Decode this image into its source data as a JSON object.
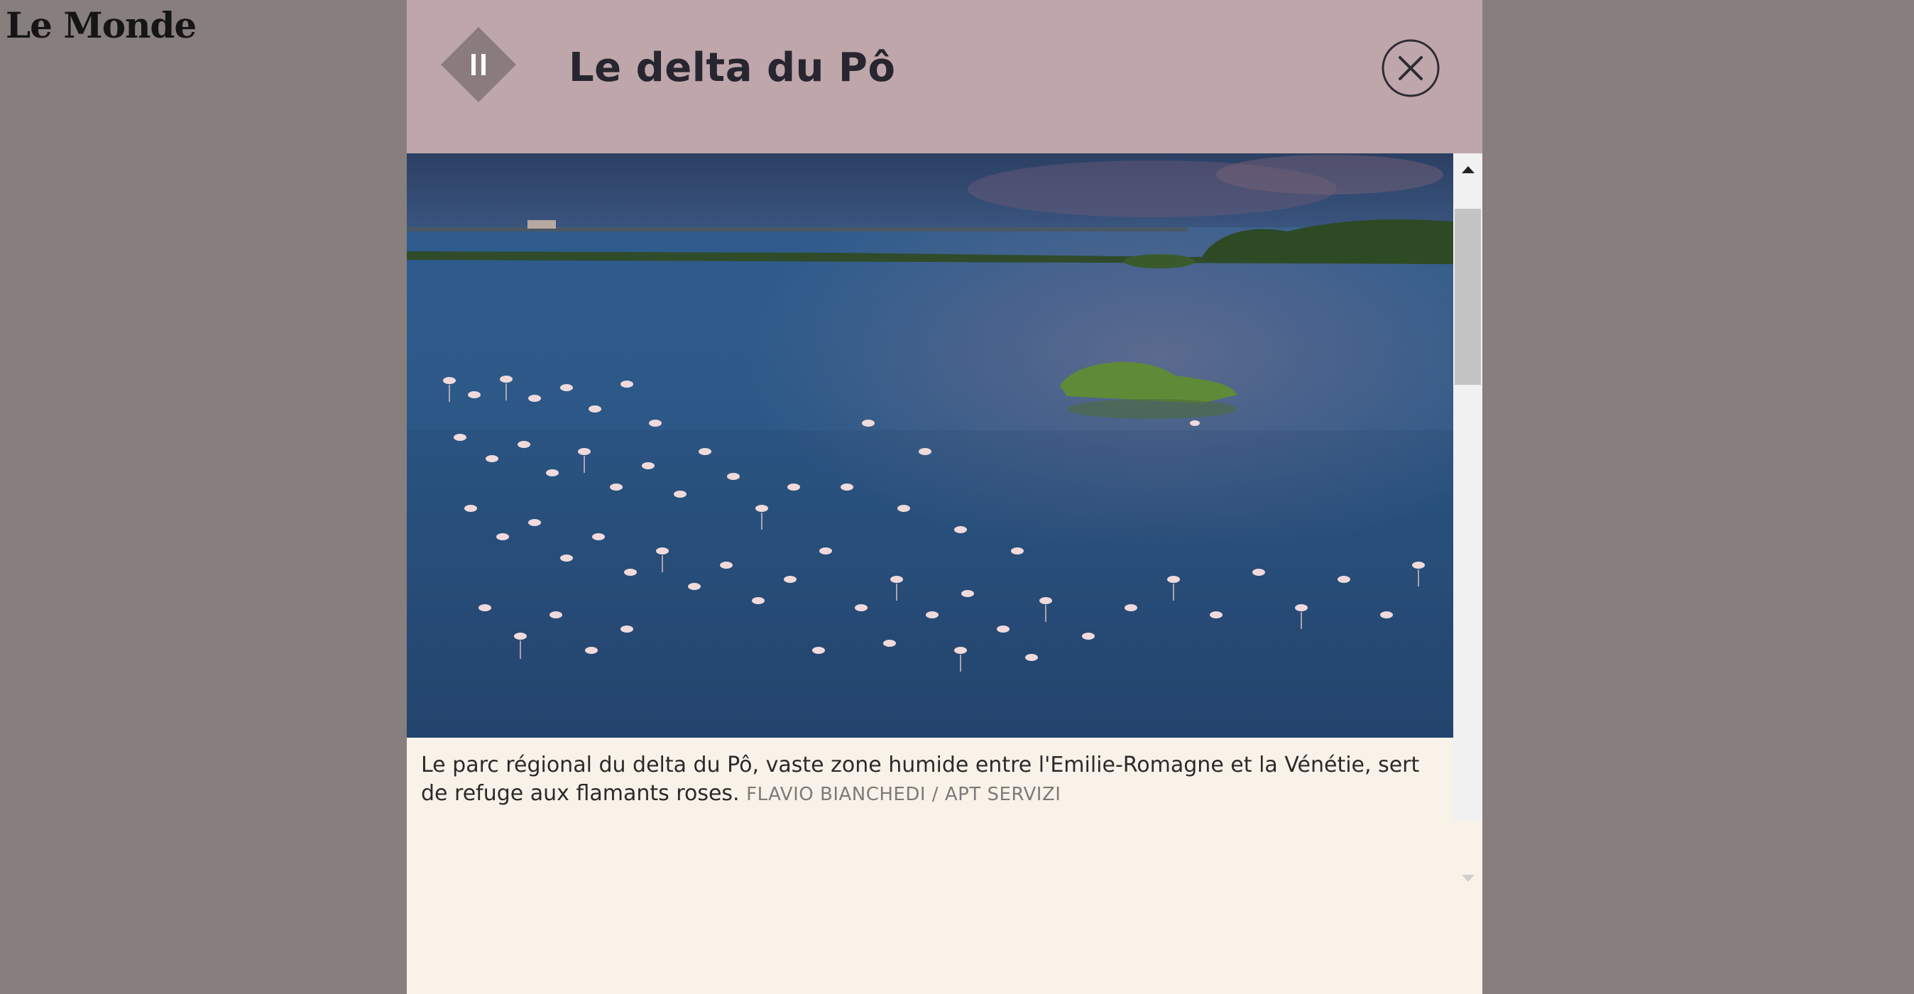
{
  "site": {
    "logo": "Le Monde"
  },
  "modal": {
    "title": "Le delta du Pô",
    "pause_icon": "pause-icon",
    "close_icon": "close-icon",
    "colors": {
      "header_bg": "#bfa6aa",
      "body_bg": "#f9f2e9",
      "pause_diamond": "#8a7b7d",
      "title": "#272630",
      "backdrop": "#867f7d"
    }
  },
  "photo": {
    "subject": "flamingos-in-lagoon-photo"
  },
  "caption": {
    "text": "Le parc régional du delta du Pô, vaste zone humide entre l'Emilie-Romagne et la Vénétie, sert de refuge aux flamants roses.",
    "credit": "FLAVIO BIANCHEDI / APT SERVIZI"
  }
}
